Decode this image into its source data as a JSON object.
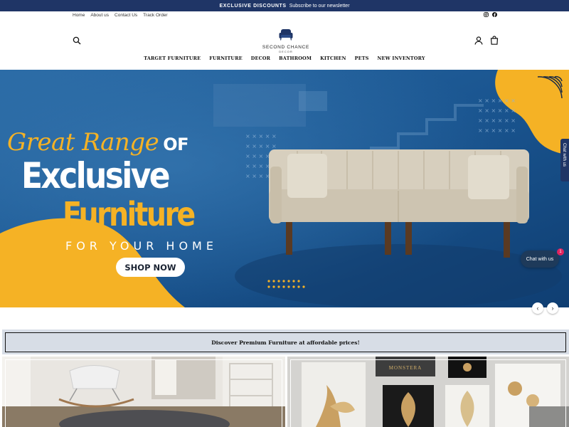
{
  "announcement": {
    "bold": "EXCLUSIVE DISCOUNTS",
    "text": "Subscribe to our newsletter"
  },
  "utility_links": [
    "Home",
    "About us",
    "Contact Us",
    "Track Order"
  ],
  "social": [
    "instagram-icon",
    "facebook-icon"
  ],
  "logo": {
    "name": "SECOND CHANCE",
    "sub": "DECOR"
  },
  "nav": [
    "TARGET FURNITURE",
    "FURNITURE",
    "DECOR",
    "BATHROOM",
    "KITCHEN",
    "PETS",
    "NEW INVENTORY"
  ],
  "hero": {
    "line1": "Great Range",
    "line1_of": "OF",
    "line2": "Exclusive",
    "line3": "Furniture",
    "line4": "FOR YOUR HOME",
    "cta": "SHOP NOW"
  },
  "slider": {
    "prev": "‹",
    "next": "›"
  },
  "chat": {
    "tab": "Chat with us",
    "bubble": "Chat with us",
    "badge": "1"
  },
  "promo": "Discover Premium Furniture at affordable prices!",
  "tiles": [
    "MONSTERA"
  ],
  "colors": {
    "navy": "#1f3566",
    "accent_yellow": "#f5b225",
    "hero_blue": "#1c4f86"
  }
}
